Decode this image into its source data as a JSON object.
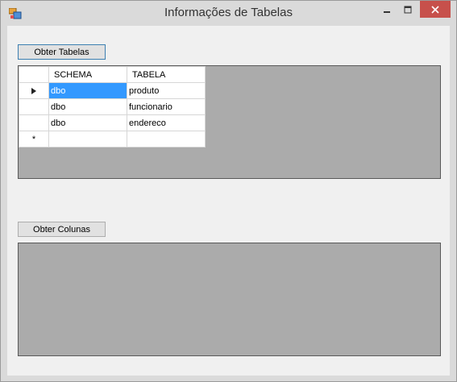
{
  "window": {
    "title": "Informações de Tabelas",
    "controls": {
      "minimize": "minimize-icon",
      "maximize": "maximize-icon",
      "close": "close-icon"
    },
    "close_color": "#c7504b"
  },
  "buttons": {
    "obter_tabelas": "Obter Tabelas",
    "obter_colunas": "Obter Colunas"
  },
  "tables_grid": {
    "columns": [
      "SCHEMA",
      "TABELA"
    ],
    "rows": [
      {
        "schema": "dbo",
        "tabela": "produto",
        "current": true,
        "selected_column": "schema"
      },
      {
        "schema": "dbo",
        "tabela": "funcionario"
      },
      {
        "schema": "dbo",
        "tabela": "endereco"
      }
    ],
    "new_row_marker": "*",
    "selection_color": "#3399ff"
  },
  "columns_grid": {
    "rows": []
  }
}
